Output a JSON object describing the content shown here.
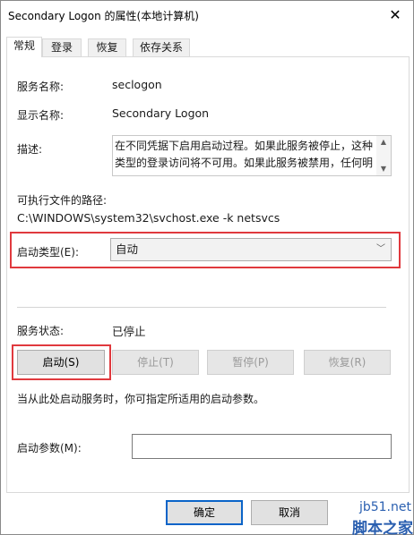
{
  "window": {
    "title": "Secondary Logon 的属性(本地计算机)",
    "close_glyph": "✕"
  },
  "tabs": [
    {
      "label": "常规"
    },
    {
      "label": "登录"
    },
    {
      "label": "恢复"
    },
    {
      "label": "依存关系"
    }
  ],
  "general": {
    "service_name_label": "服务名称:",
    "service_name_value": "seclogon",
    "display_name_label": "显示名称:",
    "display_name_value": "Secondary Logon",
    "description_label": "描述:",
    "description_line1": "在不同凭据下启用启动过程。如果此服务被停止，这种",
    "description_line2": "类型的登录访问将不可用。如果此服务被禁用，任何明",
    "exe_path_label": "可执行文件的路径:",
    "exe_path_value": "C:\\WINDOWS\\system32\\svchost.exe -k netsvcs",
    "startup_type_label": "启动类型(E):",
    "startup_type_value": "自动",
    "service_status_label": "服务状态:",
    "service_status_value": "已停止",
    "start_button": "启动(S)",
    "stop_button": "停止(T)",
    "pause_button": "暂停(P)",
    "resume_button": "恢复(R)",
    "hint_text": "当从此处启动服务时，你可指定所适用的启动参数。",
    "start_params_label": "启动参数(M):",
    "start_params_value": ""
  },
  "footer": {
    "ok_button": "确定",
    "cancel_button": "取消"
  },
  "watermark": {
    "domain": "jb51.net",
    "name": "脚本之家"
  },
  "colors": {
    "highlight_red": "#e0393e",
    "focus_blue": "#0a64c8",
    "watermark_blue": "#2a5fb0"
  }
}
